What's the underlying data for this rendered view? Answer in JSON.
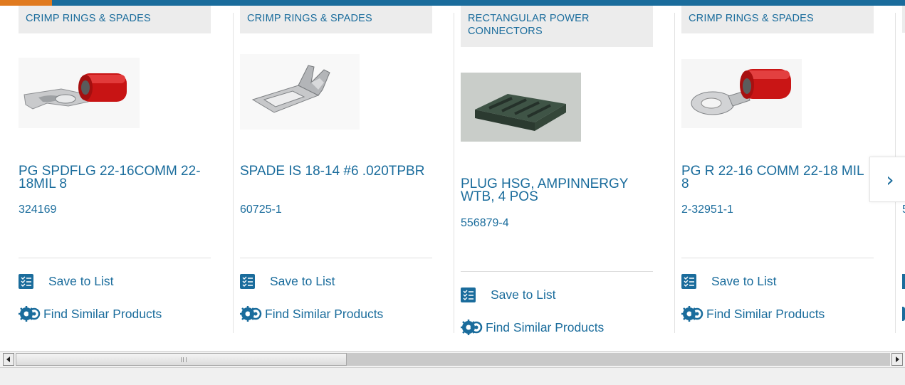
{
  "products": [
    {
      "category": "CRIMP RINGS & SPADES",
      "title": "PG SPDFLG 22-16COMM 22-18MIL 8",
      "part_number": "324169",
      "image_icon": "red-flanged-spade-terminal"
    },
    {
      "category": "CRIMP RINGS & SPADES",
      "title": "SPADE IS 18-14 #6 .020TPBR",
      "part_number": "60725-1",
      "image_icon": "silver-spade-terminal"
    },
    {
      "category": "RECTANGULAR POWER CONNECTORS",
      "title": "PLUG HSG, AMPINNERGY WTB, 4 POS",
      "part_number": "556879-4",
      "image_icon": "dark-green-plug-housing"
    },
    {
      "category": "CRIMP RINGS & SPADES",
      "title": "PG R 22-16 COMM 22-18 MIL 8",
      "part_number": "2-32951-1",
      "image_icon": "red-ring-terminal"
    }
  ],
  "actions": {
    "save_label": "Save to List",
    "similar_label": "Find Similar Products"
  },
  "partial_card": {
    "part_number_fragment": "5"
  },
  "carousel": {
    "next_glyph": "›"
  },
  "colors": {
    "link_blue": "#1a6c9c",
    "top_bar": "#1a6c9c",
    "top_bar_accent": "#e07a1f",
    "category_bg": "#ececec"
  }
}
